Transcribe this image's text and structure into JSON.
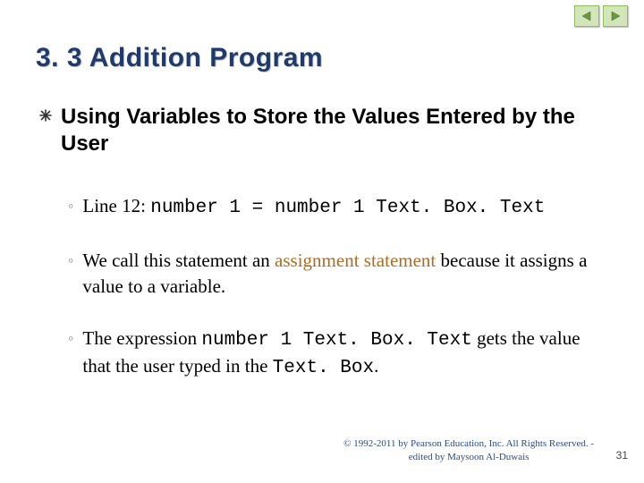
{
  "nav": {
    "prev_icon_name": "triangle-left-icon",
    "next_icon_name": "triangle-right-icon"
  },
  "title": "3. 3  Addition Program",
  "main_bullet": "Using Variables to Store the Values Entered by the User",
  "sub_items": [
    {
      "prefix": "Line 12:   ",
      "code": "number 1 = number 1 Text. Box. Text"
    },
    {
      "text_before": "We call this statement an ",
      "accent": "assignment statement",
      "text_after": " because it assigns a value to a variable."
    },
    {
      "text_before": "The expression ",
      "code1": "number 1 Text. Box. Text",
      "text_mid": " gets the value that the user typed in the ",
      "code2": "Text. Box",
      "text_after": "."
    }
  ],
  "footer": {
    "line1": "© 1992-2011 by Pearson Education, Inc. All Rights Reserved. -",
    "line2": "edited by Maysoon Al-Duwais"
  },
  "page_number": "31",
  "colors": {
    "title": "#1f3b6e",
    "accent": "#b36b1f",
    "footer": "#2a4a8a",
    "arrow_fill": "#6a9a3c"
  }
}
